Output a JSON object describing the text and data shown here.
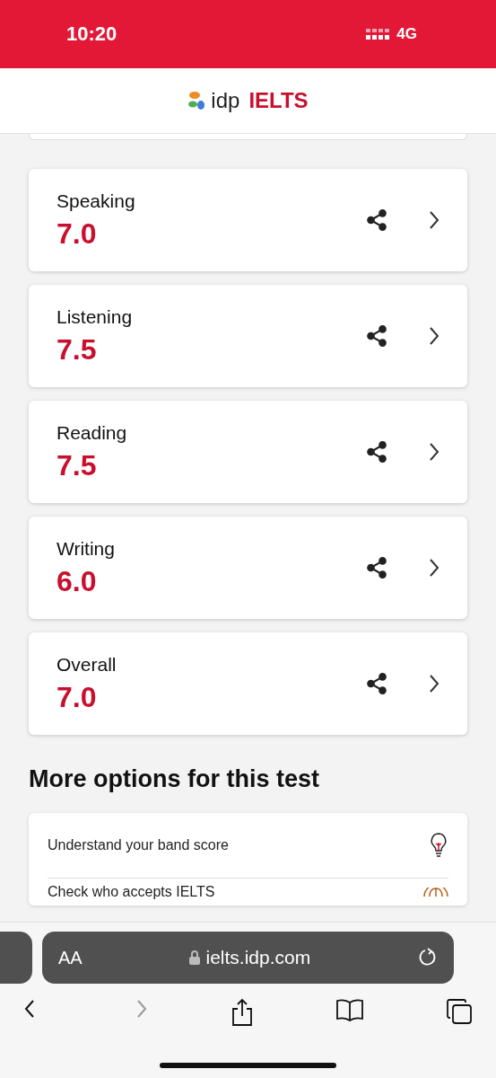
{
  "status_bar": {
    "time": "10:20",
    "network": "4G"
  },
  "header": {
    "logo_text": "idp",
    "brand": "IELTS"
  },
  "scores": [
    {
      "label": "Speaking",
      "score": "7.0"
    },
    {
      "label": "Listening",
      "score": "7.5"
    },
    {
      "label": "Reading",
      "score": "7.5"
    },
    {
      "label": "Writing",
      "score": "6.0"
    },
    {
      "label": "Overall",
      "score": "7.0"
    }
  ],
  "more_options": {
    "title": "More options for this test",
    "items": [
      {
        "label": "Understand your band score",
        "kind": "bulb"
      },
      {
        "label": "Check who accepts IELTS",
        "kind": "globe"
      }
    ]
  },
  "browser": {
    "text_size": "AA",
    "url": "ielts.idp.com"
  }
}
